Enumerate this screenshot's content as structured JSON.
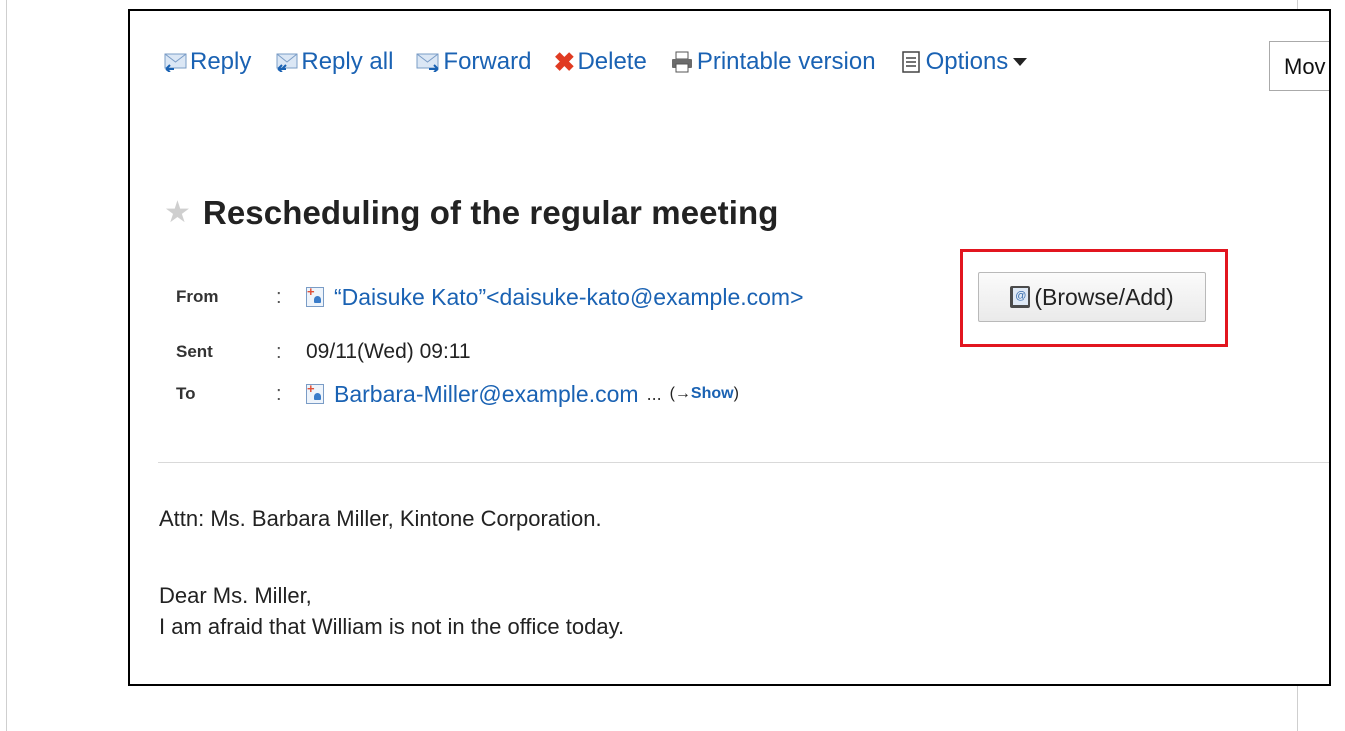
{
  "toolbar": {
    "reply": "Reply",
    "reply_all": "Reply all",
    "forward": "Forward",
    "delete": "Delete",
    "printable": "Printable version",
    "options": "Options",
    "move": "Mov",
    "icons": {
      "reply": "reply-icon",
      "reply_all": "reply-all-icon",
      "forward": "forward-icon",
      "delete": "delete-x-icon",
      "printable": "printer-icon",
      "options": "list-icon"
    }
  },
  "message": {
    "subject": "Rescheduling of the regular meeting",
    "from_label": "From",
    "from_value": "“Daisuke Kato”<daisuke-kato@example.com>",
    "browse_add": "(Browse/Add)",
    "sent_label": "Sent",
    "sent_value": "09/11(Wed) 09:11",
    "to_label": "To",
    "to_value": "Barbara-Miller@example.com",
    "to_more": "...",
    "show_open": "(→",
    "show_link": "Show",
    "show_close": ")",
    "colon": ":"
  },
  "body": {
    "line1": "Attn: Ms. Barbara Miller, Kintone Corporation.",
    "line2": "Dear Ms. Miller,",
    "line3": "I am afraid that William is not in the office today."
  },
  "colors": {
    "link": "#1a62b3",
    "highlight": "#e2151f",
    "delete_icon": "#e03b22"
  }
}
